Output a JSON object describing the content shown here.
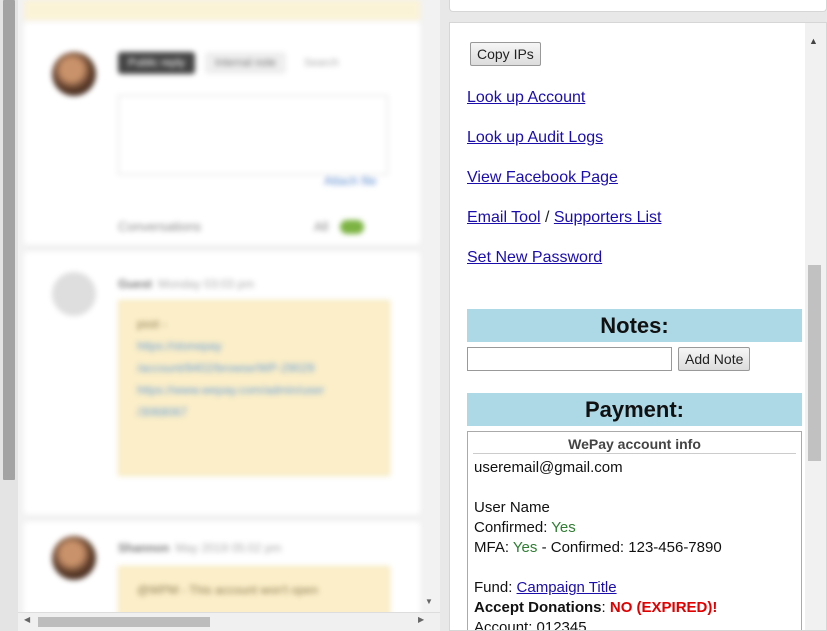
{
  "left": {
    "reply_tabs": [
      "Public reply",
      "Internal note",
      "Search"
    ],
    "attach_label": "Attach file",
    "conversations_label": "Conversations",
    "all_label": "All",
    "guest_name": "Guest",
    "guest_time": "Monday 03:03 pm",
    "guest_message": [
      "psst -",
      "https://stonepay",
      "/account/8402/browse/WP-29029",
      "https://www.wepay.com/admin/user",
      "/3068067"
    ],
    "agent_name": "Shannon",
    "agent_time": "May 2019 05:02 pm",
    "agent_message": [
      "@WPM - This account won't open"
    ]
  },
  "right": {
    "copy_ips_label": "Copy IPs",
    "links": {
      "look_up_account": "Look up Account",
      "look_up_audit_logs": "Look up Audit Logs",
      "view_facebook_page": "View Facebook Page",
      "email_tool": "Email Tool",
      "separator": "/",
      "supporters_list": "Supporters List",
      "set_new_password": "Set New Password"
    },
    "notes": {
      "header": "Notes:",
      "input_value": "",
      "add_note_label": "Add Note"
    },
    "payment": {
      "header": "Payment:",
      "wepay_title": "WePay account info",
      "email": "useremail@gmail.com",
      "user_name": "User Name",
      "confirmed_label": "Confirmed:",
      "confirmed_value": "Yes",
      "mfa_label": "MFA:",
      "mfa_value": "Yes",
      "mfa_confirmed": "- Confirmed: 123-456-7890",
      "fund_label": "Fund:",
      "fund_link": "Campaign Title",
      "accept_donations_label": "Accept Donations",
      "accept_donations_sep": ":",
      "accept_donations_value": "NO (EXPIRED)!",
      "account_line": "Account: 012345"
    }
  },
  "colors": {
    "section_header_bg": "#add8e6",
    "link": "#1a0dab",
    "green": "#2e7d32",
    "red": "#e00000"
  }
}
